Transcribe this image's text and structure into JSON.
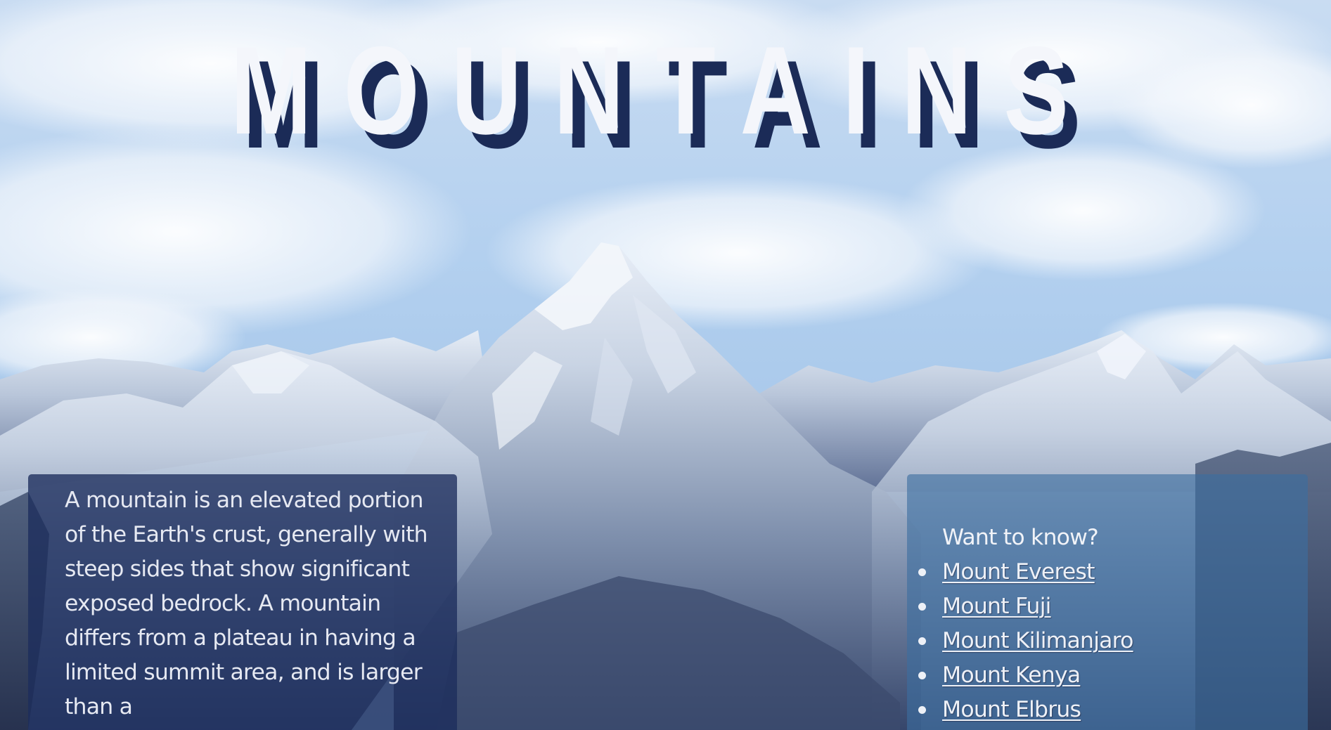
{
  "page": {
    "title": "MOUNTAINS"
  },
  "intro": {
    "text": "A mountain is an elevated portion of the Earth's crust, generally with steep sides that show significant exposed bedrock. A mountain differs from a plateau in having a limited summit area, and is larger than a"
  },
  "links_panel": {
    "heading": "Want to know?",
    "items": [
      {
        "label": "Mount Everest"
      },
      {
        "label": "Mount Fuji"
      },
      {
        "label": "Mount Kilimanjaro"
      },
      {
        "label": "Mount Kenya"
      },
      {
        "label": "Mount Elbrus"
      }
    ]
  },
  "colors": {
    "title_fill": "#f4f6fb",
    "title_shadow": "#1b2b57",
    "info_panel": "#1c2d5c",
    "links_panel": "#3c6ea0",
    "sky": "#a9c9ec"
  }
}
